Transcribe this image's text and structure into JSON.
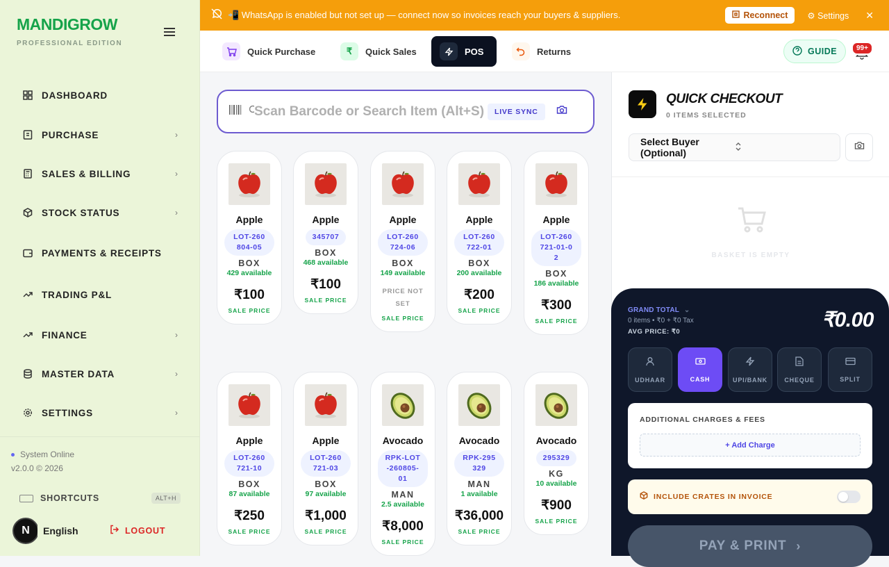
{
  "brand": {
    "name": "MANDIGROW",
    "edition": "PROFESSIONAL EDITION"
  },
  "nav": [
    {
      "label": "DASHBOARD",
      "icon": "dashboard-icon",
      "chevron": false
    },
    {
      "label": "PURCHASE",
      "icon": "purchase-icon",
      "chevron": true
    },
    {
      "label": "SALES & BILLING",
      "icon": "billing-icon",
      "chevron": true
    },
    {
      "label": "STOCK STATUS",
      "icon": "box-icon",
      "chevron": true
    },
    {
      "label": "PAYMENTS & RECEIPTS",
      "icon": "wallet-icon",
      "chevron": false
    },
    {
      "label": "TRADING P&L",
      "icon": "trend-icon",
      "chevron": false
    },
    {
      "label": "FINANCE",
      "icon": "trend-icon",
      "chevron": true
    },
    {
      "label": "MASTER DATA",
      "icon": "database-icon",
      "chevron": true
    },
    {
      "label": "SETTINGS",
      "icon": "gear-icon",
      "chevron": true
    }
  ],
  "footer": {
    "status": "System Online",
    "version": "v2.0.0 © 2026",
    "shortcuts": "SHORTCUTS",
    "shortcut_key": "ALT+H",
    "avatar_letter": "N",
    "language": "English",
    "logout": "LOGOUT"
  },
  "banner": {
    "message": "📲 WhatsApp is enabled but not set up — connect now so invoices reach your buyers & suppliers.",
    "reconnect": "Reconnect",
    "settings": "Settings",
    "close": "✕"
  },
  "tabs": [
    {
      "label": "Quick Purchase",
      "icon": "cart-icon",
      "active": false
    },
    {
      "label": "Quick Sales",
      "icon": "rupee-icon",
      "active": false
    },
    {
      "label": "POS",
      "icon": "bolt-icon",
      "active": true
    },
    {
      "label": "Returns",
      "icon": "undo-icon",
      "active": false
    }
  ],
  "header": {
    "guide": "GUIDE",
    "notif_count": "99+"
  },
  "search": {
    "placeholder": "Scan Barcode or Search Item (Alt+S)",
    "sync": "LIVE SYNC"
  },
  "products": [
    {
      "name": "Apple",
      "lot": "LOT-260804-05",
      "unit": "BOX",
      "avail": "429 available",
      "price": "₹100",
      "price_label": "SALE PRICE",
      "kind": "apple"
    },
    {
      "name": "Apple",
      "lot": "345707",
      "unit": "BOX",
      "avail": "468 available",
      "price": "₹100",
      "price_label": "SALE PRICE",
      "kind": "apple"
    },
    {
      "name": "Apple",
      "lot": "LOT-260724-06",
      "unit": "BOX",
      "avail": "149 available",
      "price": "",
      "price_note": "PRICE NOT SET",
      "price_label": "SALE PRICE",
      "kind": "apple"
    },
    {
      "name": "Apple",
      "lot": "LOT-260722-01",
      "unit": "BOX",
      "avail": "200 available",
      "price": "₹200",
      "price_label": "SALE PRICE",
      "kind": "apple"
    },
    {
      "name": "Apple",
      "lot": "LOT-260721-01-02",
      "unit": "BOX",
      "avail": "186 available",
      "price": "₹300",
      "price_label": "SALE PRICE",
      "kind": "apple"
    },
    {
      "name": "Apple",
      "lot": "LOT-260721-10",
      "unit": "BOX",
      "avail": "87 available",
      "price": "₹250",
      "price_label": "SALE PRICE",
      "kind": "apple"
    },
    {
      "name": "Apple",
      "lot": "LOT-260721-03",
      "unit": "BOX",
      "avail": "97 available",
      "price": "₹1,000",
      "price_label": "SALE PRICE",
      "kind": "apple"
    },
    {
      "name": "Avocado",
      "lot": "RPK-LOT-260805-01",
      "unit": "MAN",
      "avail": "2.5 available",
      "price": "₹8,000",
      "price_label": "SALE PRICE",
      "kind": "avocado"
    },
    {
      "name": "Avocado",
      "lot": "RPK-295329",
      "unit": "MAN",
      "avail": "1 available",
      "price": "₹36,000",
      "price_label": "SALE PRICE",
      "kind": "avocado"
    },
    {
      "name": "Avocado",
      "lot": "295329",
      "unit": "KG",
      "avail": "10 available",
      "price": "₹900",
      "price_label": "SALE PRICE",
      "kind": "avocado"
    }
  ],
  "checkout": {
    "title": "QUICK CHECKOUT",
    "subtitle": "0 ITEMS SELECTED",
    "buyer_placeholder": "Select Buyer (Optional)",
    "empty": "BASKET IS EMPTY"
  },
  "payment": {
    "grand_total_label": "GRAND TOTAL",
    "breakdown": "0 items • ₹0 + ₹0 Tax",
    "avg_price": "AVG PRICE: ₹0",
    "total": "₹0.00",
    "methods": [
      {
        "label": "UDHAAR",
        "icon": "user-icon",
        "active": false
      },
      {
        "label": "CASH",
        "icon": "cash-icon",
        "active": true
      },
      {
        "label": "UPI/BANK",
        "icon": "bolt-icon",
        "active": false
      },
      {
        "label": "CHEQUE",
        "icon": "document-icon",
        "active": false
      },
      {
        "label": "SPLIT",
        "icon": "card-icon",
        "active": false
      }
    ],
    "charges_title": "ADDITIONAL CHARGES & FEES",
    "add_charge": "+ Add Charge",
    "crates": "INCLUDE CRATES IN INVOICE",
    "pay_button": "PAY & PRINT"
  },
  "colors": {
    "accent": "#6d4cf5",
    "brand": "#16a34a",
    "banner": "#f59e0b",
    "dark": "#0f172a"
  }
}
